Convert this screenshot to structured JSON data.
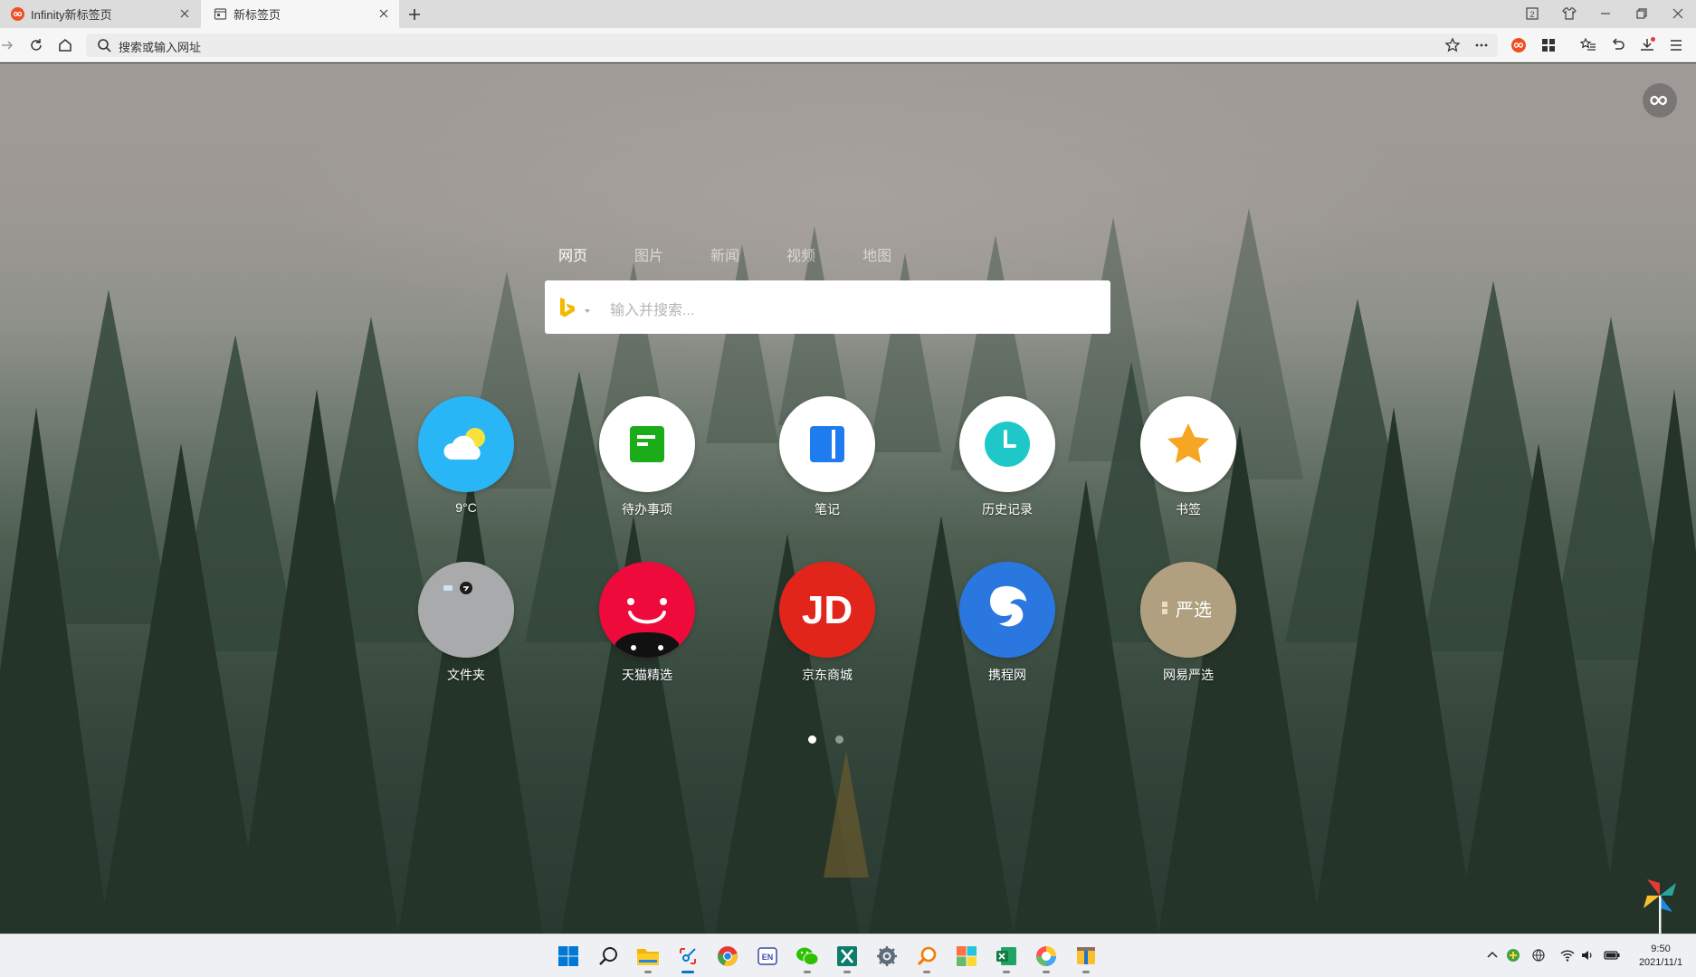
{
  "tabs": [
    {
      "title": "Infinity新标签页",
      "active": false
    },
    {
      "title": "新标签页",
      "active": true
    }
  ],
  "toolbar": {
    "address_placeholder": "搜索或输入网址"
  },
  "search": {
    "tabs": [
      "网页",
      "图片",
      "新闻",
      "视频",
      "地图"
    ],
    "active_tab": "网页",
    "placeholder": "输入并搜索...",
    "engine_icon": "bing-icon"
  },
  "tiles": [
    {
      "label": "9°C",
      "icon": "weather-icon",
      "color": "#29b6f6"
    },
    {
      "label": "待办事项",
      "icon": "todo-icon",
      "color": "#1aad19"
    },
    {
      "label": "笔记",
      "icon": "notes-icon",
      "color": "#1e7bf0"
    },
    {
      "label": "历史记录",
      "icon": "history-icon",
      "color": "#1fc8c8"
    },
    {
      "label": "书签",
      "icon": "bookmark-star-icon",
      "color": "#f5a623"
    },
    {
      "label": "文件夹",
      "icon": "folder-icon",
      "color": "#a9aaab"
    },
    {
      "label": "天猫精选",
      "icon": "tmall-icon",
      "color": "#ee0a3a"
    },
    {
      "label": "京东商城",
      "icon": "jd-icon",
      "color": "#e1251b",
      "text": "JD"
    },
    {
      "label": "携程网",
      "icon": "ctrip-icon",
      "color": "#2a77e0"
    },
    {
      "label": "网易严选",
      "icon": "yanxuan-icon",
      "color": "#b0a07f",
      "text": "严选"
    }
  ],
  "pagination": {
    "pages": 2,
    "current": 1
  },
  "taskbar": {
    "apps": [
      "windows-start-icon",
      "search-icon",
      "file-explorer-icon",
      "snipping-tool-icon",
      "chrome-icon",
      "input-method-icon",
      "wechat-icon",
      "xmind-icon",
      "settings-icon",
      "search-tool-icon",
      "photos-icon",
      "excel-icon",
      "browser-icon",
      "archive-icon"
    ]
  },
  "clock": {
    "time": "9:50",
    "date": "2021/11/1"
  }
}
